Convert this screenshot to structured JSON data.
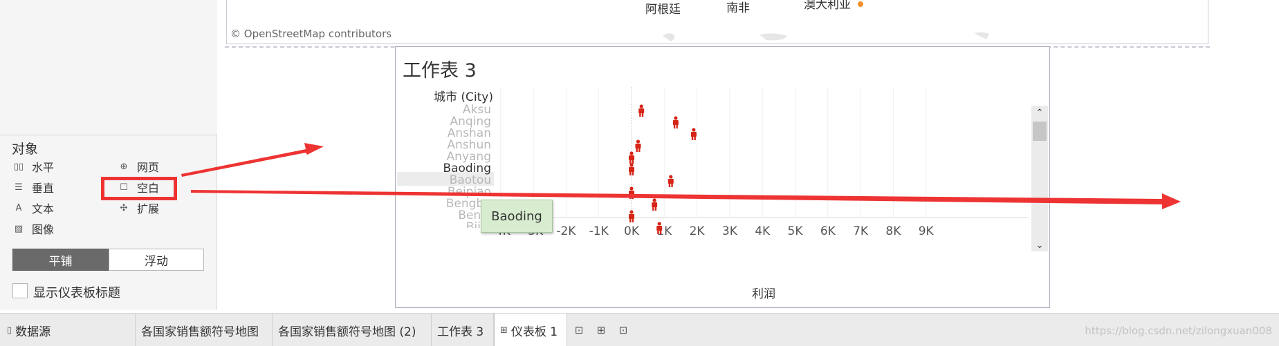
{
  "left_panel": {
    "objects_title": "对象",
    "objects": [
      {
        "label": "水平",
        "icon": "horizontal-container-icon"
      },
      {
        "label": "网页",
        "icon": "web-page-icon"
      },
      {
        "label": "垂直",
        "icon": "vertical-container-icon"
      },
      {
        "label": "空白",
        "icon": "blank-icon"
      },
      {
        "label": "文本",
        "icon": "text-icon"
      },
      {
        "label": "扩展",
        "icon": "extension-icon"
      },
      {
        "label": "图像",
        "icon": "image-icon"
      }
    ],
    "layout_toggle": {
      "tiled": "平铺",
      "floating": "浮动",
      "selected": "平铺"
    },
    "show_title_checkbox": {
      "label": "显示仪表板标题",
      "checked": false
    }
  },
  "map": {
    "labels": [
      "阿根廷",
      "南非",
      "澳大利亚"
    ],
    "attribution": "© OpenStreetMap contributors",
    "dot_color": "#f28e2b"
  },
  "worksheet": {
    "title": "工作表 3",
    "row_header": "城市 (City)",
    "x_axis_title": "利润",
    "tooltip": "Baoding",
    "selected_city": "Baoding",
    "mark_color": "#d62416"
  },
  "chart_data": {
    "type": "scatter",
    "title": "工作表 3",
    "xlabel": "利润",
    "ylabel": "城市 (City)",
    "x_ticks": [
      "-4K",
      "-3K",
      "-2K",
      "-1K",
      "0K",
      "1K",
      "2K",
      "3K",
      "4K",
      "5K",
      "6K",
      "7K",
      "8K",
      "9K"
    ],
    "xlim": [
      -4000,
      9000
    ],
    "grid": true,
    "categories": [
      "Aksu",
      "Anqing",
      "Anshan",
      "Anshun",
      "Anyang",
      "Baoding",
      "Baotou",
      "Beipiao",
      "Bengbu",
      "Benxi",
      "Bijie"
    ],
    "values": [
      300,
      1350,
      1900,
      200,
      0,
      0,
      1200,
      0,
      700,
      0,
      850
    ]
  },
  "tabs": [
    {
      "label": "数据源",
      "icon": "data-source-icon",
      "active": false
    },
    {
      "label": "各国家销售额符号地图",
      "icon": "",
      "active": false
    },
    {
      "label": "各国家销售额符号地图 (2)",
      "icon": "",
      "active": false
    },
    {
      "label": "工作表 3",
      "icon": "",
      "active": false
    },
    {
      "label": "仪表板 1",
      "icon": "dashboard-icon",
      "active": true
    }
  ],
  "watermark": "https://blog.csdn.net/zilongxuan008"
}
